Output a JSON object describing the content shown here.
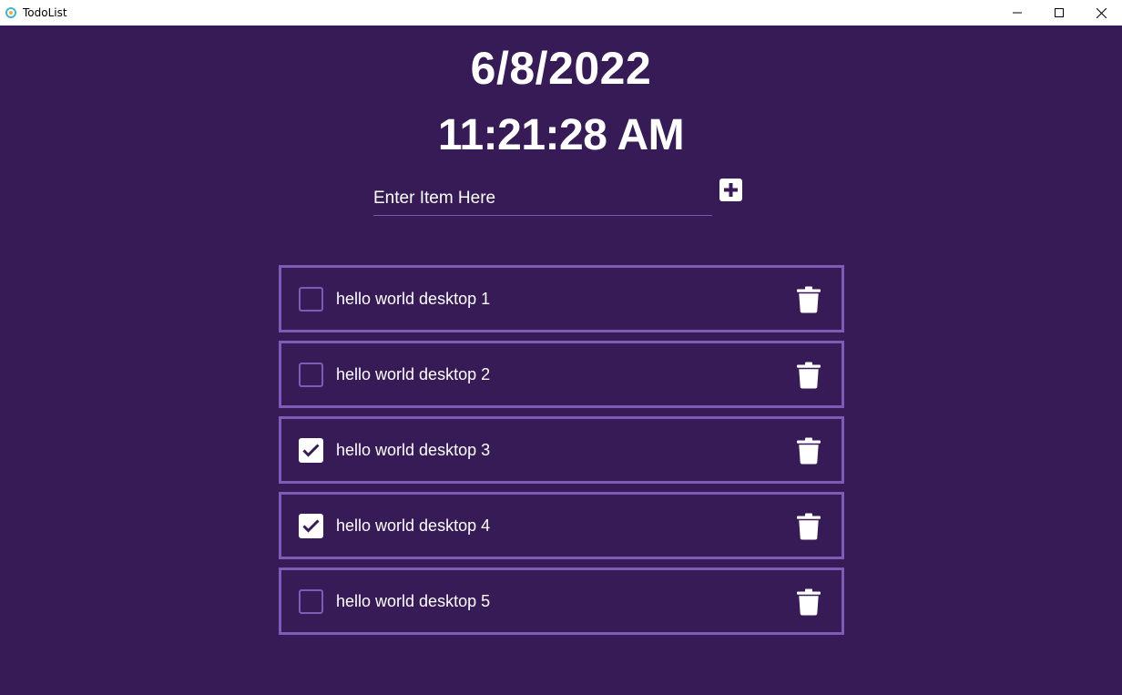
{
  "window": {
    "title": "TodoList",
    "minimize_glyph": "minimize-icon",
    "maximize_glyph": "maximize-icon",
    "close_glyph": "close-icon"
  },
  "clock": {
    "date": "6/8/2022",
    "time": "11:21:28 AM"
  },
  "input": {
    "placeholder": "Enter Item Here",
    "value": ""
  },
  "add_button_icon": "plus-icon",
  "todos": [
    {
      "text": "hello world desktop 1",
      "checked": false
    },
    {
      "text": "hello world desktop 2",
      "checked": false
    },
    {
      "text": "hello world desktop 3",
      "checked": true
    },
    {
      "text": "hello world desktop 4",
      "checked": true
    },
    {
      "text": "hello world desktop 5",
      "checked": false
    }
  ],
  "colors": {
    "background": "#361b57",
    "accent_border": "#7d5bb6",
    "text": "#ffffff"
  }
}
